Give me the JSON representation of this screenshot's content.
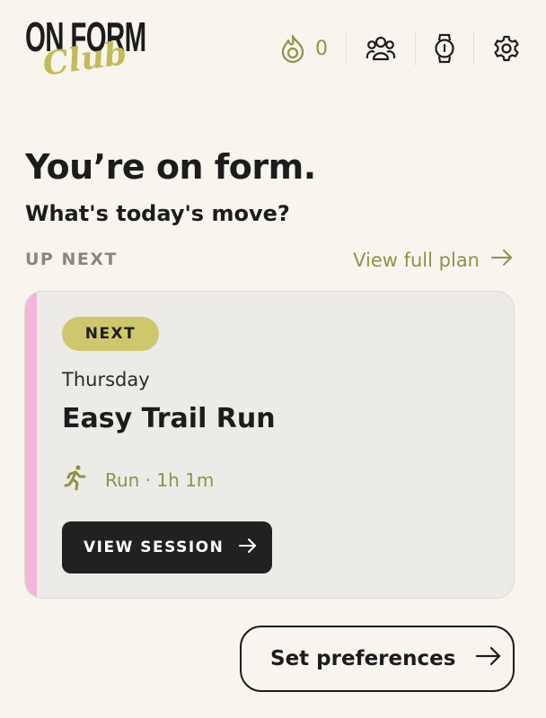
{
  "brand": {
    "logo_main": "ON FORM",
    "logo_sub": "Club"
  },
  "header": {
    "streak_count": "0",
    "icons": [
      "flame-icon",
      "community-icon",
      "watch-icon",
      "gear-icon"
    ]
  },
  "hero": {
    "headline": "You’re on form.",
    "subheadline": "What's today's move?"
  },
  "up_next": {
    "label": "UP NEXT",
    "view_plan_label": "View full plan"
  },
  "session_card": {
    "badge": "NEXT",
    "day": "Thursday",
    "title": "Easy Trail Run",
    "meta": "Run · 1h 1m",
    "button_label": "VIEW SESSION"
  },
  "preferences": {
    "button_label": "Set preferences"
  },
  "colors": {
    "background": "#f8f5ef",
    "accent_olive": "#8b9446",
    "badge": "#cfc76b",
    "card_accent": "#f5b5dd",
    "dark_button": "#212121"
  }
}
